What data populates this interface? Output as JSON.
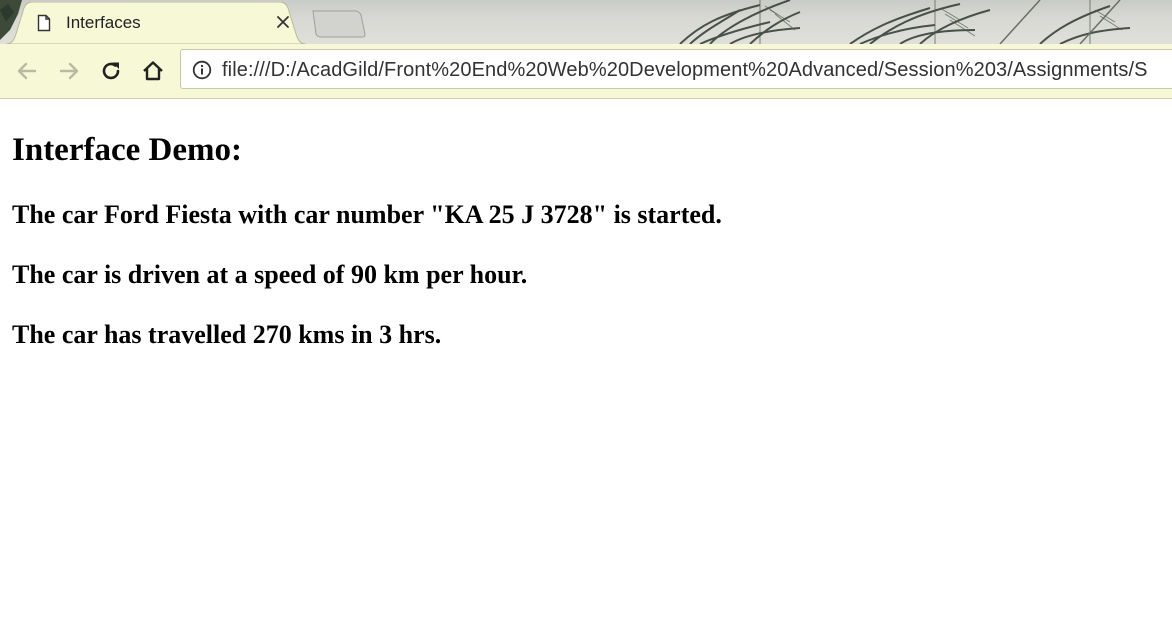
{
  "tab": {
    "title": "Interfaces",
    "favicon_icon": "page-icon",
    "close_icon": "close-icon"
  },
  "toolbar": {
    "back_icon": "arrow-left-icon",
    "forward_icon": "arrow-right-icon",
    "reload_icon": "reload-icon",
    "home_icon": "home-icon",
    "info_icon": "info-icon",
    "url": "file:///D:/AcadGild/Front%20End%20Web%20Development%20Advanced/Session%203/Assignments/S"
  },
  "page": {
    "heading": "Interface Demo:",
    "lines": [
      "The car Ford Fiesta with car number \"KA 25 J 3728\" is started.",
      "The car is driven at a speed of 90 km per hour.",
      "The car has travelled 270 kms in 3 hrs."
    ]
  },
  "colors": {
    "toolbar_bg": "#f7f9d6",
    "tab_bg": "#f7f9d6",
    "content_bg": "#ffffff",
    "text": "#000000"
  }
}
